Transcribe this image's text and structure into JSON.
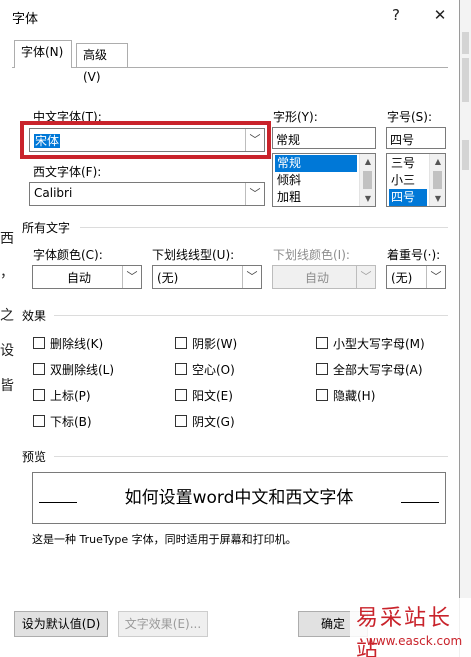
{
  "dialog": {
    "title": "字体",
    "help_label": "?",
    "close_label": "✕"
  },
  "tabs": [
    {
      "label": "字体(N)",
      "active": true
    },
    {
      "label": "高级(V)",
      "active": false
    }
  ],
  "font": {
    "chinese_label": "中文字体(T):",
    "chinese_value": "宋体",
    "western_label": "西文字体(F):",
    "western_value": "Calibri",
    "style_label": "字形(Y):",
    "style_value": "常规",
    "style_options": [
      "常规",
      "倾斜",
      "加粗"
    ],
    "size_label": "字号(S):",
    "size_value": "四号",
    "size_options": [
      "三号",
      "小三",
      "四号"
    ]
  },
  "all_text": {
    "section_label": "所有文字",
    "font_color_label": "字体颜色(C):",
    "font_color_value": "自动",
    "underline_label": "下划线线型(U):",
    "underline_value": "(无)",
    "underline_color_label": "下划线颜色(I):",
    "underline_color_value": "自动",
    "emphasis_label": "着重号(·):",
    "emphasis_value": "(无)"
  },
  "effects": {
    "section_label": "效果",
    "items": [
      {
        "label": "删除线(K)"
      },
      {
        "label": "阴影(W)"
      },
      {
        "label": "小型大写字母(M)"
      },
      {
        "label": "双删除线(L)"
      },
      {
        "label": "空心(O)"
      },
      {
        "label": "全部大写字母(A)"
      },
      {
        "label": "上标(P)"
      },
      {
        "label": "阳文(E)"
      },
      {
        "label": "隐藏(H)"
      },
      {
        "label": "下标(B)"
      },
      {
        "label": "阴文(G)"
      }
    ]
  },
  "preview": {
    "section_label": "预览",
    "sample_text": "如何设置word中文和西文字体",
    "note": "这是一种 TrueType 字体，同时适用于屏幕和打印机。"
  },
  "buttons": {
    "set_default": "设为默认值(D)",
    "text_effects": "文字效果(E)...",
    "ok": "确定"
  },
  "background_doc": {
    "chars": [
      "西",
      "，",
      "之",
      "设",
      "皆"
    ]
  },
  "watermark": {
    "brand": "易采站长站",
    "url": "www.easck.com"
  },
  "colors": {
    "highlight": "#0078d7",
    "annotation_red": "#c9232b"
  }
}
